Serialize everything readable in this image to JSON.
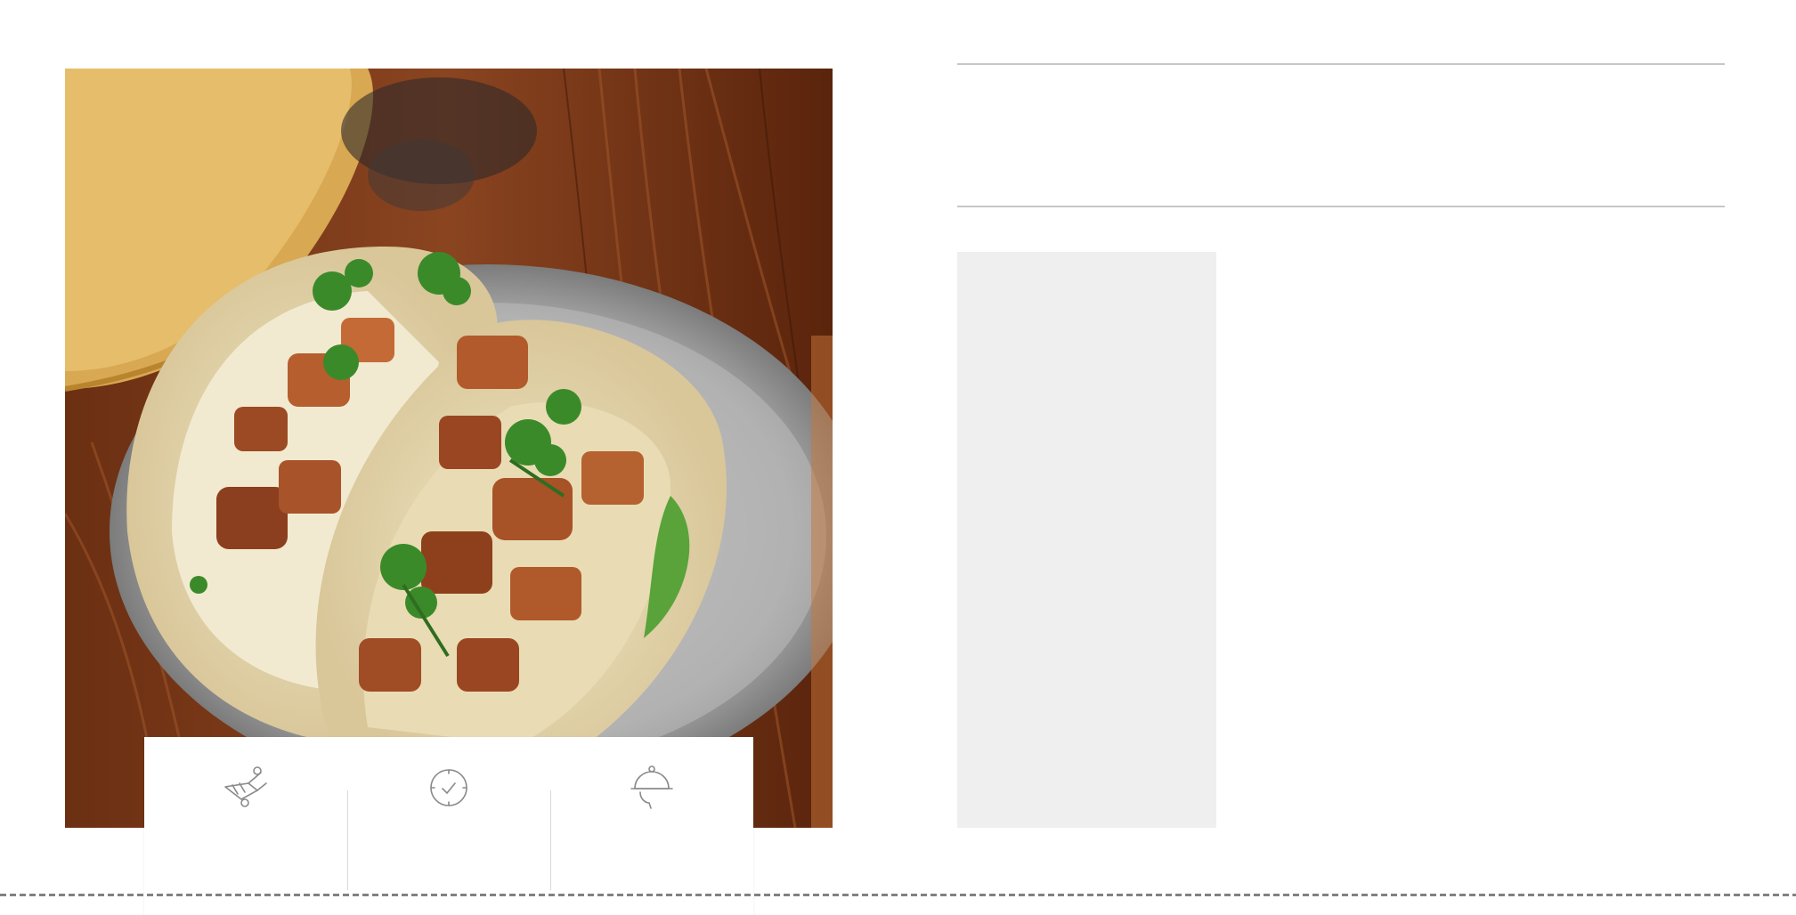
{
  "photo": {
    "subject": "tacos-photo"
  },
  "info_card": {
    "items": [
      {
        "icon": "prep-knife-icon",
        "label": "",
        "value": ""
      },
      {
        "icon": "clock-icon",
        "label": "",
        "value": ""
      },
      {
        "icon": "cloche-serving-icon",
        "label": "",
        "value": ""
      }
    ]
  },
  "recipe": {
    "title": "",
    "sidebar_text": "",
    "body_text": ""
  },
  "colors": {
    "rule": "#c7c7c7",
    "panel": "#efefef",
    "icon_stroke": "#8a8a8a"
  }
}
